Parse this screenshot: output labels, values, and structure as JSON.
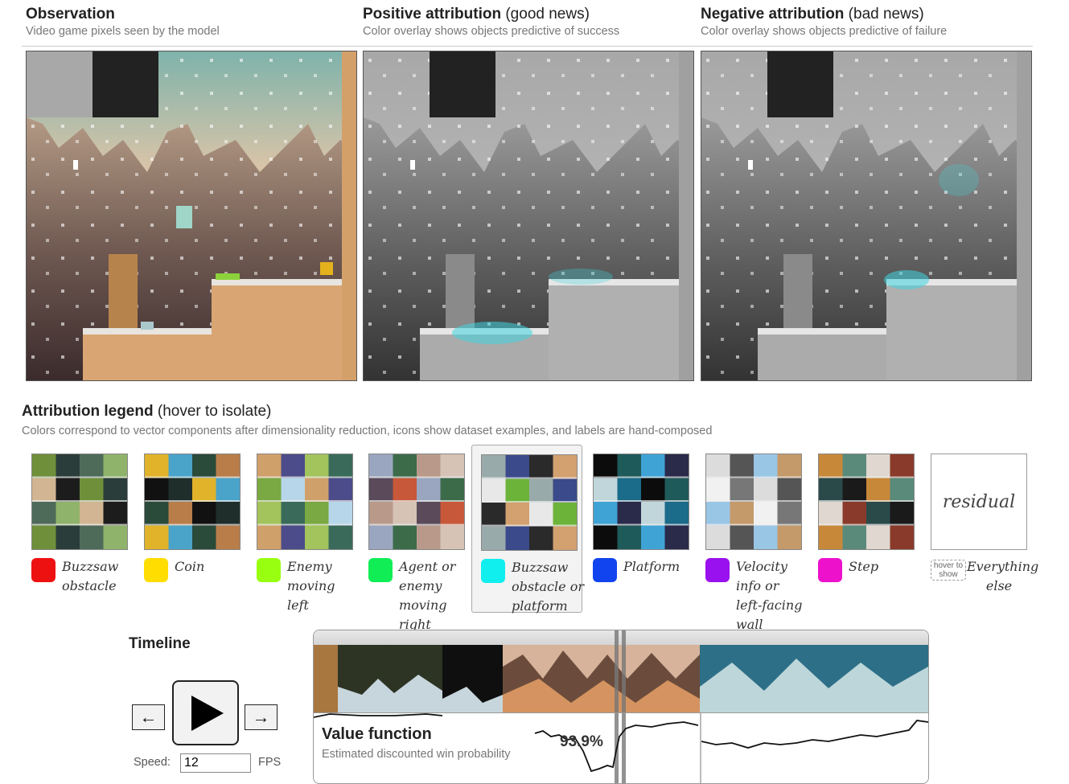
{
  "panels": [
    {
      "title_bold": "Observation",
      "title_rest": "",
      "subtitle": "Video game pixels seen by the model"
    },
    {
      "title_bold": "Positive attribution",
      "title_rest": " (good news)",
      "subtitle": "Color overlay shows objects predictive of success"
    },
    {
      "title_bold": "Negative attribution",
      "title_rest": " (bad news)",
      "subtitle": "Color overlay shows objects predictive of failure"
    }
  ],
  "legend": {
    "title_bold": "Attribution legend",
    "title_rest": " (hover to isolate)",
    "subtitle": "Colors correspond to vector components after dimensionality reduction, icons show dataset examples, and labels are hand-composed",
    "items": [
      {
        "label": "Buzzsaw obstacle",
        "color": "#ee1111"
      },
      {
        "label": "Coin",
        "color": "#ffdd00"
      },
      {
        "label": "Enemy moving left",
        "color": "#99ff11"
      },
      {
        "label": "Agent or enemy moving right",
        "color": "#11ee55"
      },
      {
        "label": "Buzzsaw obstacle or platform",
        "color": "#11eeee"
      },
      {
        "label": "Platform",
        "color": "#1144ee"
      },
      {
        "label": "Velocity info or left-facing wall",
        "color": "#9911ee"
      },
      {
        "label": "Step",
        "color": "#ee11cc"
      }
    ],
    "residual": {
      "box_label": "residual",
      "hover_note": "hover to show",
      "label": "Everything else"
    }
  },
  "timeline": {
    "title": "Timeline",
    "prev_icon": "left-arrow-icon",
    "prev_label": "←",
    "next_label": "→",
    "play_icon": "play-icon",
    "speed_label": "Speed:",
    "speed_value": "12",
    "fps_label": "FPS",
    "value_title": "Value function",
    "value_subtitle": "Estimated discounted win probability",
    "value_readout": "93.9%"
  }
}
